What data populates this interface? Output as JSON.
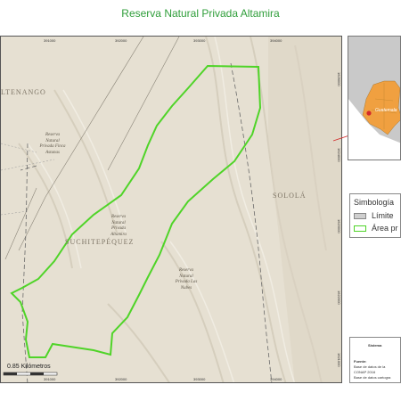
{
  "title": "Reserva Natural Privada Altamira",
  "map": {
    "top_ticks": [
      "391000",
      "392000",
      "393000",
      "394000"
    ],
    "bottom_ticks": [
      "391000",
      "392000",
      "393000",
      "394000"
    ],
    "right_ticks": [
      "1626000",
      "1624000",
      "1623000",
      "1622000",
      "1621000"
    ],
    "places": {
      "tenango": "LTENANGO",
      "suchitepequez": "SUCHITEPÉQUEZ",
      "solola": "SOLOLÁ"
    },
    "annotations": {
      "finca_astunas": [
        "Reserva",
        "Natural",
        "Privada Finca",
        "Astunas"
      ],
      "altamira": [
        "Reserva",
        "Natural",
        "Privada",
        "Altamira"
      ],
      "las_nubes": [
        "Reserva",
        "Natural",
        "Privada Las",
        "Nubes"
      ]
    },
    "scale_label": "0.85 Kilómetros"
  },
  "inset": {
    "label": "Guatemala",
    "colors": {
      "country": "#f0a040",
      "outside": "#c9c9c9",
      "sea": "#ffffff"
    }
  },
  "legend": {
    "title": "Simbología",
    "items": [
      {
        "label": "Límite",
        "color": "#cfcfcf",
        "border": "#888888"
      },
      {
        "label": "Área pr",
        "color": "#ffffff",
        "border": "#4fd428"
      }
    ]
  },
  "info": {
    "heading": "Sistema",
    "source_label": "Fuente:",
    "source_lines": [
      "Base de datos de la",
      "CONAP 2016",
      "Base de datos cartogra"
    ]
  },
  "colors": {
    "title": "#2f9e3a",
    "boundary": "#4fd428",
    "relief": "#e9e3d6"
  }
}
